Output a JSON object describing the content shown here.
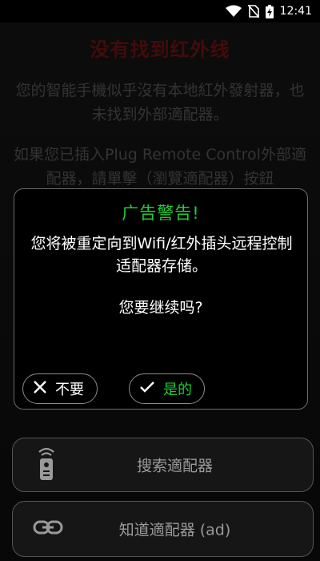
{
  "status_bar": {
    "time": "12:41"
  },
  "background": {
    "title": "没有找到红外线",
    "paragraph1": "您的智能手機似乎沒有本地紅外發射器，也未找到外部適配器。",
    "paragraph2": "如果您已插入Plug Remote Control外部適配器，請單擊（瀏覽適配器）按鈕"
  },
  "dialog": {
    "title": "广告警告!",
    "message": "您将被重定向到Wifi/红外插头远程控制适配器存储。",
    "question": "您要继续吗?",
    "no_label": "不要",
    "yes_label": "是的"
  },
  "buttons": {
    "search_label": "搜索適配器",
    "know_label": "知道適配器 (ad)"
  },
  "colors": {
    "accent_green": "#22cc33",
    "title_red": "#7a1414"
  }
}
